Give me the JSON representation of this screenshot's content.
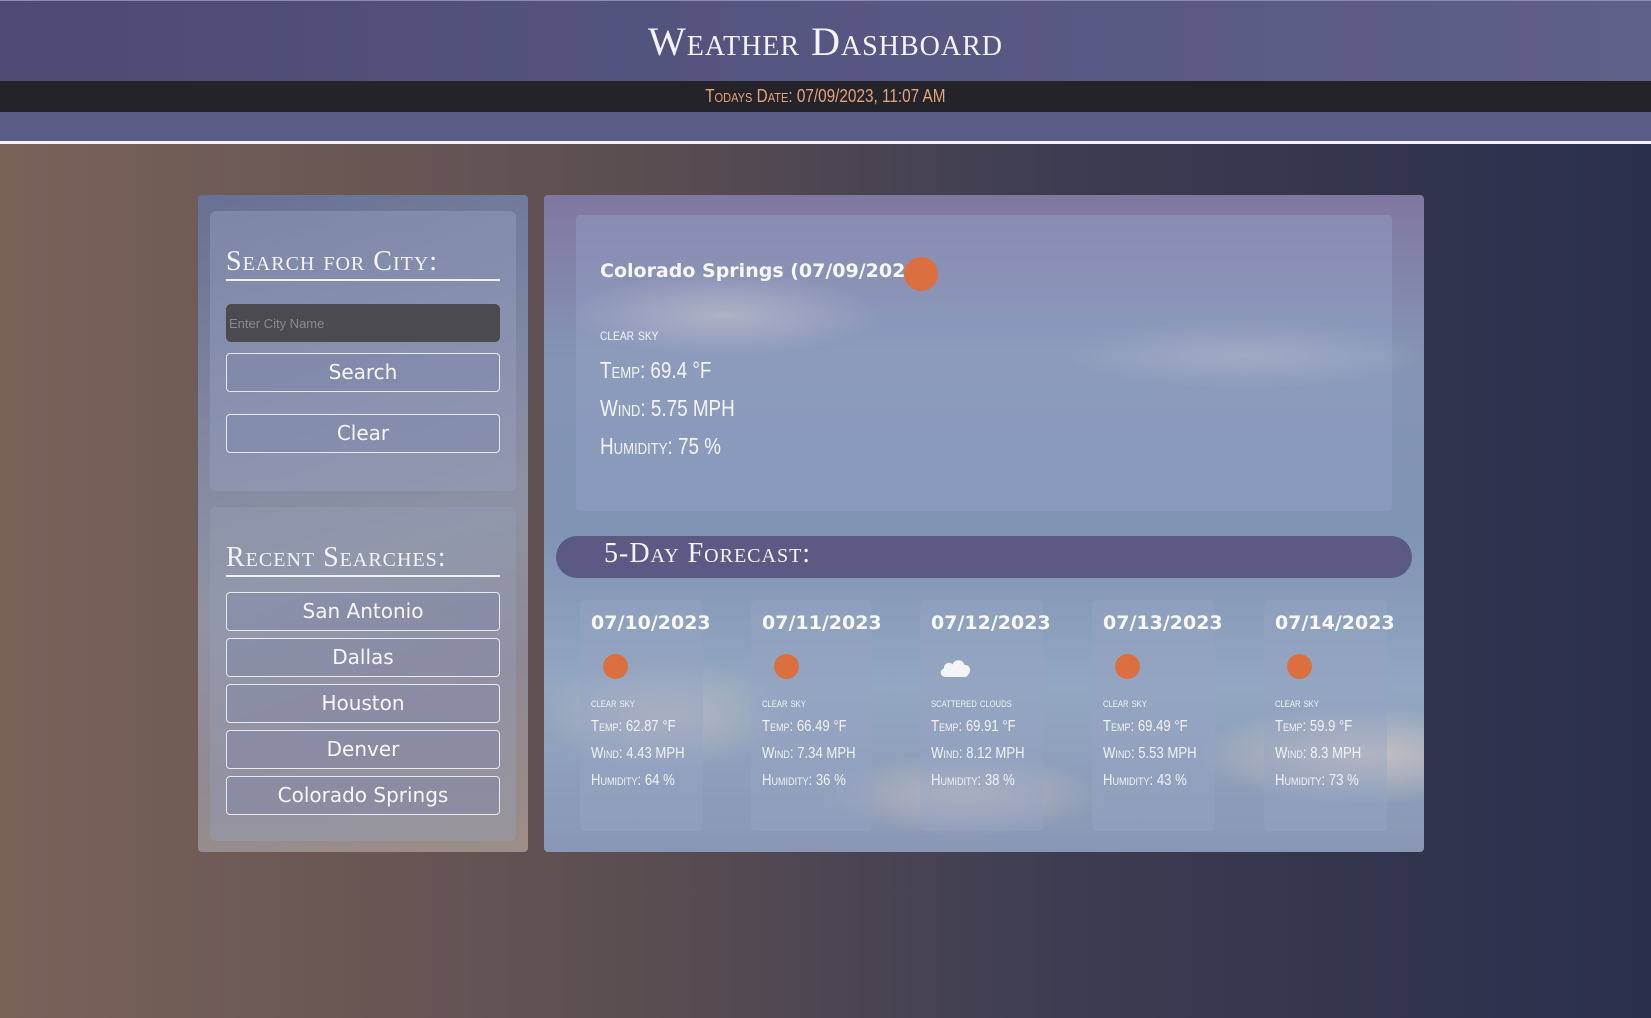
{
  "header": {
    "title": "Weather Dashboard"
  },
  "datebar": {
    "text": "Todays Date: 07/09/2023, 11:07 AM"
  },
  "search": {
    "title": "Search for City:",
    "placeholder": "Enter City Name",
    "value": "",
    "search_label": "Search",
    "clear_label": "Clear"
  },
  "recent": {
    "title": "Recent Searches:",
    "items": [
      "San Antonio",
      "Dallas",
      "Houston",
      "Denver",
      "Colorado Springs"
    ]
  },
  "current": {
    "city": "Colorado Springs (07/09/2023)",
    "icon": "sun-icon",
    "description": "clear sky",
    "temp": "Temp: 69.4 °F",
    "wind": "Wind: 5.75 MPH",
    "humidity": "Humidity: 75 %"
  },
  "forecast": {
    "title": "5-Day Forecast:",
    "days": [
      {
        "date": "07/10/2023",
        "icon": "sun-icon",
        "description": "clear sky",
        "temp": "Temp: 62.87 °F",
        "wind": "Wind: 4.43 MPH",
        "humidity": "Humidity: 64 %"
      },
      {
        "date": "07/11/2023",
        "icon": "sun-icon",
        "description": "clear sky",
        "temp": "Temp: 66.49 °F",
        "wind": "Wind: 7.34 MPH",
        "humidity": "Humidity: 36 %"
      },
      {
        "date": "07/12/2023",
        "icon": "cloud-icon",
        "description": "scattered clouds",
        "temp": "Temp: 69.91 °F",
        "wind": "Wind: 8.12 MPH",
        "humidity": "Humidity: 38 %"
      },
      {
        "date": "07/13/2023",
        "icon": "sun-icon",
        "description": "clear sky",
        "temp": "Temp: 69.49 °F",
        "wind": "Wind: 5.53 MPH",
        "humidity": "Humidity: 43 %"
      },
      {
        "date": "07/14/2023",
        "icon": "sun-icon",
        "description": "clear sky",
        "temp": "Temp: 59.9 °F",
        "wind": "Wind: 8.3 MPH",
        "humidity": "Humidity: 73 %"
      }
    ]
  },
  "colors": {
    "sun": "#dc6f3f",
    "accent": "#e3a37d",
    "header": "#555681"
  }
}
